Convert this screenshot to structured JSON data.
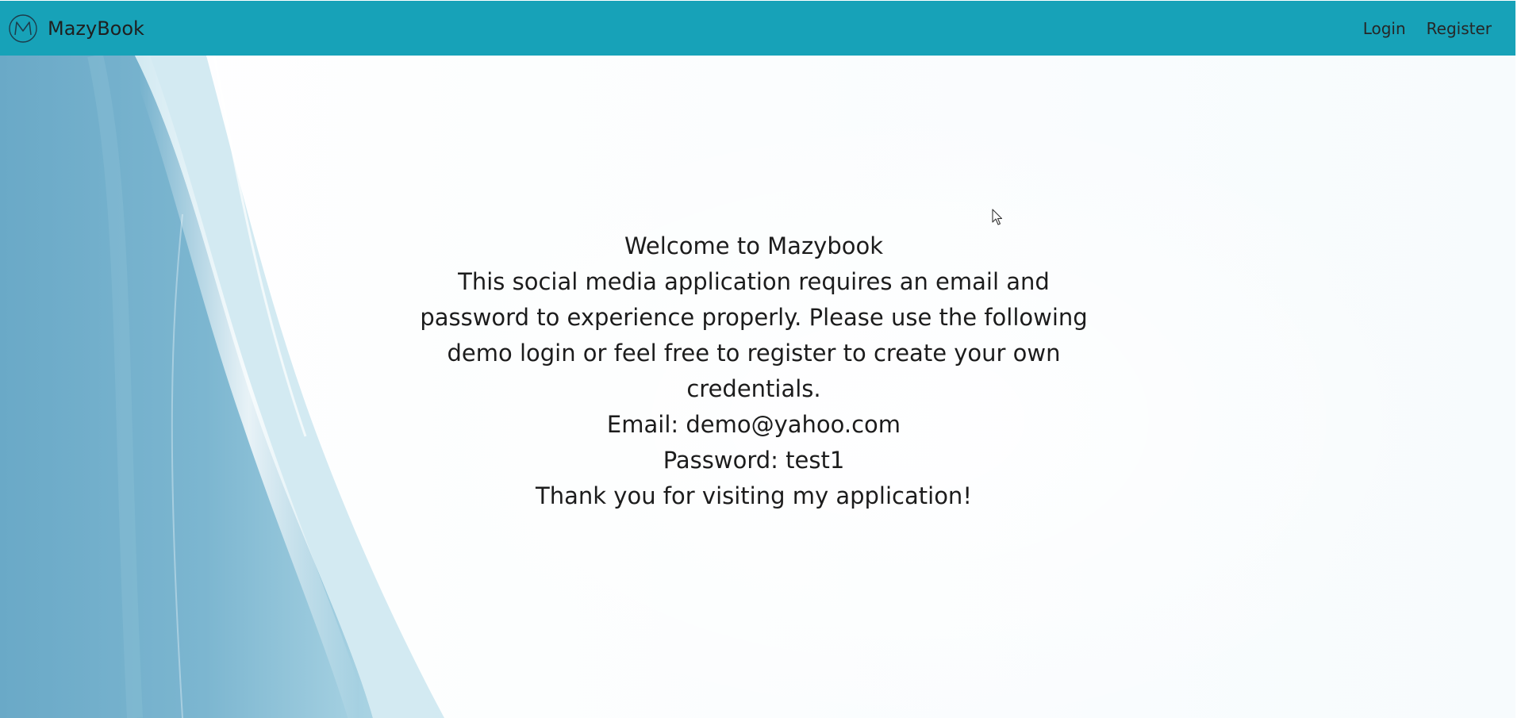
{
  "navbar": {
    "brand": "MazyBook",
    "logo_icon": "mazybook-m-logo-icon",
    "links": {
      "login": "Login",
      "register": "Register"
    },
    "color": "#17a2b8"
  },
  "hero": {
    "heading": "Welcome to Mazybook",
    "description": "This social media application requires an email and password to experience properly. Please use the following demo login or feel free to register to create your own credentials.",
    "email_line": "Email: demo@yahoo.com",
    "password_line": "Password: test1",
    "thanks": "Thank you for visiting my application!",
    "background_color": "#72aecb"
  }
}
